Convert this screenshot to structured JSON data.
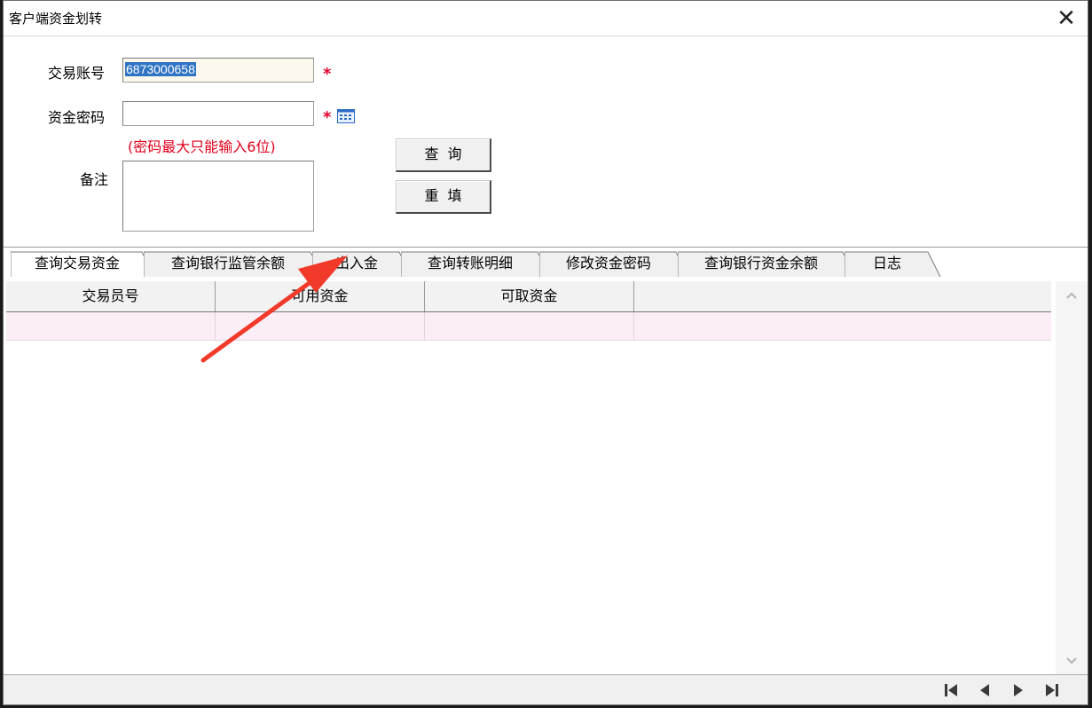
{
  "window": {
    "title": "客户端资金划转",
    "close_glyph": "✕"
  },
  "form": {
    "account_label": "交易账号",
    "account_value": "6873000658",
    "password_label": "资金密码",
    "password_value": "",
    "password_hint": "(密码最大只能输入6位)",
    "remark_label": "备注",
    "remark_value": "",
    "required_mark": "*",
    "keyboard_icon": "keyboard-icon"
  },
  "buttons": {
    "query": "查询",
    "reset": "重填"
  },
  "tabs": [
    {
      "label": "查询交易资金",
      "active": true
    },
    {
      "label": "查询银行监管余额",
      "active": false
    },
    {
      "label": "出入金",
      "active": false
    },
    {
      "label": "查询转账明细",
      "active": false
    },
    {
      "label": "修改资金密码",
      "active": false
    },
    {
      "label": "查询银行资金余额",
      "active": false
    },
    {
      "label": "日志",
      "active": false
    }
  ],
  "grid": {
    "columns": [
      "交易员号",
      "可用资金",
      "可取资金",
      ""
    ],
    "rows": [
      [
        "",
        "",
        "",
        ""
      ]
    ]
  },
  "annotation": {
    "arrow_color": "#f23a2a",
    "icon": "red-arrow-icon"
  },
  "navigation": {
    "icons": [
      "first-page-icon",
      "prev-page-icon",
      "next-page-icon",
      "last-page-icon"
    ]
  },
  "colors": {
    "required": "#e4002b",
    "selection": "#3074c4",
    "row_highlight": "#fbeef7"
  }
}
